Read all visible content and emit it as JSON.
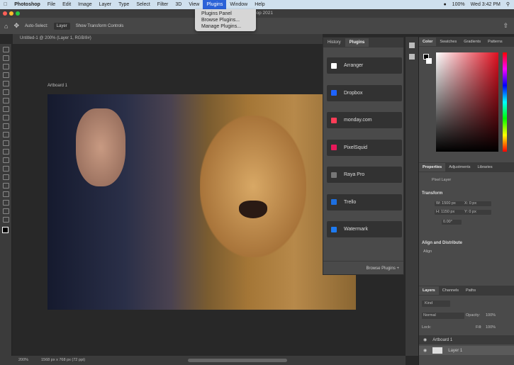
{
  "menubar": {
    "apple": "",
    "app": "Photoshop",
    "items": [
      "File",
      "Edit",
      "Image",
      "Layer",
      "Type",
      "Select",
      "Filter",
      "3D",
      "View",
      "Plugins",
      "Window",
      "Help"
    ],
    "battery": "100%",
    "clock": "Wed 3:42 PM"
  },
  "plugins_menu": [
    "Plugins Panel",
    "Browse Plugins...",
    "Manage Plugins..."
  ],
  "window_title": "Adobe Photoshop 2021",
  "options": {
    "auto_select": "Auto-Select:",
    "layer": "Layer",
    "show_transform": "Show Transform Controls"
  },
  "document_tab": "Untitled-1 @ 200% (Layer 1, RGB/8#)",
  "artboard_label": "Artboard 1",
  "plugins_panel": {
    "tabs": [
      "History",
      "Plugins"
    ],
    "active_tab": "Plugins",
    "items": [
      {
        "label": "Arranger",
        "color": "#ffffff"
      },
      {
        "label": "Dropbox",
        "color": "#1e63ff"
      },
      {
        "label": "monday.com",
        "color": "#ff3d57"
      },
      {
        "label": "PixelSquid",
        "color": "#e8185a"
      },
      {
        "label": "Raya Pro",
        "color": "#777777"
      },
      {
        "label": "Trello",
        "color": "#1d6fe0"
      },
      {
        "label": "Watermark",
        "color": "#1e7bf2"
      }
    ],
    "browse": "Browse Plugins"
  },
  "color_panel": {
    "tabs": [
      "Color",
      "Swatches",
      "Gradients",
      "Patterns"
    ]
  },
  "properties": {
    "tabs": [
      "Properties",
      "Adjustments",
      "Libraries"
    ],
    "kind": "Pixel Layer",
    "transform": "Transform",
    "w": "W: 1500 px",
    "x": "X: 0 px",
    "h": "H: 1150 px",
    "y": "Y: 0 px",
    "angle": "0.00°",
    "align_section": "Align and Distribute",
    "align": "Align"
  },
  "layers": {
    "tabs": [
      "Layers",
      "Channels",
      "Paths"
    ],
    "kind": "Kind",
    "blend": "Normal",
    "opacity_label": "Opacity:",
    "opacity": "100%",
    "lock": "Lock:",
    "fill_label": "Fill:",
    "fill": "100%",
    "items": [
      "Artboard 1",
      "Layer 1"
    ]
  },
  "statusbar": {
    "zoom": "200%",
    "doc_size": "1568 px x 768 px (72 ppi)"
  }
}
